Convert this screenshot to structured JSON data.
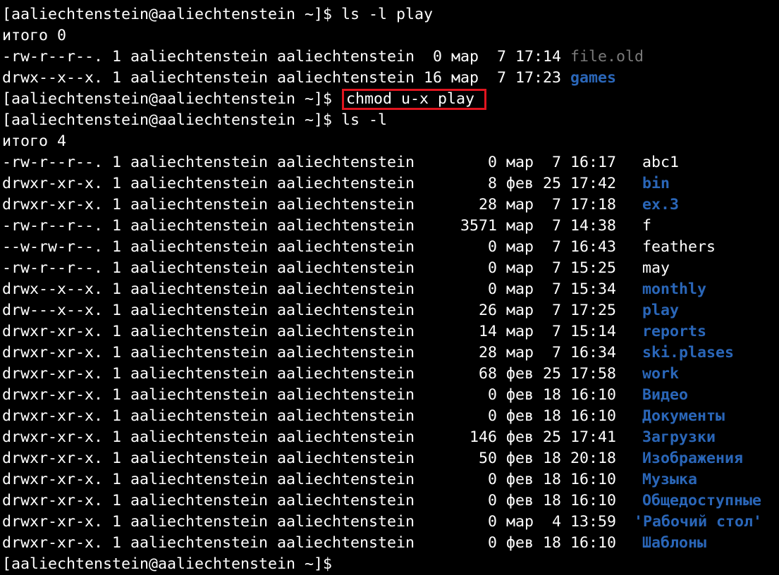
{
  "terminal": {
    "prompt": "[aaliechtenstein@aaliechtenstein ~]$ ",
    "commands": {
      "first": "ls -l play",
      "second": "chmod u-x play",
      "third": "ls -l"
    },
    "totals": {
      "first": "итого 0",
      "second": "итого 4"
    },
    "colors": {
      "background": "#000000",
      "text": "#ffffff",
      "directory": "#2a66b8",
      "dim_file": "#7a7a7a",
      "highlight_box": "#e0151f"
    },
    "play_listing": [
      {
        "cols": "-rw-r--r--. 1 aaliechtenstein aaliechtenstein  0 мар  7 17:14 ",
        "name": "file.old",
        "kind": "dim"
      },
      {
        "cols": "drwx--x--x. 1 aaliechtenstein aaliechtenstein 16 мар  7 17:23 ",
        "name": "games",
        "kind": "dir"
      }
    ],
    "home_listing": [
      {
        "cols": "-rw-r--r--. 1 aaliechtenstein aaliechtenstein",
        "time": "   0 мар  7 16:17",
        "name": "abc1",
        "kind": "file"
      },
      {
        "cols": "drwxr-xr-x. 1 aaliechtenstein aaliechtenstein",
        "time": "   8 фев 25 17:42",
        "name": "bin",
        "kind": "dir"
      },
      {
        "cols": "drwxr-xr-x. 1 aaliechtenstein aaliechtenstein",
        "time": "  28 мар  7 17:18",
        "name": "ex.3",
        "kind": "dir"
      },
      {
        "cols": "-rw-r--r--. 1 aaliechtenstein aaliechtenstein",
        "time": "3571 мар  7 14:38",
        "name": "f",
        "kind": "file"
      },
      {
        "cols": "--w-rw-r--. 1 aaliechtenstein aaliechtenstein",
        "time": "   0 мар  7 16:43",
        "name": "feathers",
        "kind": "file"
      },
      {
        "cols": "-rw-r--r--. 1 aaliechtenstein aaliechtenstein",
        "time": "   0 мар  7 15:25",
        "name": "may",
        "kind": "file"
      },
      {
        "cols": "drwx--x--x. 1 aaliechtenstein aaliechtenstein",
        "time": "   0 мар  7 15:34",
        "name": "monthly",
        "kind": "dir"
      },
      {
        "cols": "drw---x--x. 1 aaliechtenstein aaliechtenstein",
        "time": "  26 мар  7 17:25",
        "name": "play",
        "kind": "dir"
      },
      {
        "cols": "drwxr-xr-x. 1 aaliechtenstein aaliechtenstein",
        "time": "  14 мар  7 15:14",
        "name": "reports",
        "kind": "dir"
      },
      {
        "cols": "drwxr-xr-x. 1 aaliechtenstein aaliechtenstein",
        "time": "  28 мар  7 16:34",
        "name": "ski.plases",
        "kind": "dir"
      },
      {
        "cols": "drwxr-xr-x. 1 aaliechtenstein aaliechtenstein",
        "time": "  68 фев 25 17:58",
        "name": "work",
        "kind": "dir"
      },
      {
        "cols": "drwxr-xr-x. 1 aaliechtenstein aaliechtenstein",
        "time": "   0 фев 18 16:10",
        "name": "Видео",
        "kind": "dir"
      },
      {
        "cols": "drwxr-xr-x. 1 aaliechtenstein aaliechtenstein",
        "time": "   0 фев 18 16:10",
        "name": "Документы",
        "kind": "dir"
      },
      {
        "cols": "drwxr-xr-x. 1 aaliechtenstein aaliechtenstein",
        "time": " 146 фев 25 17:41",
        "name": "Загрузки",
        "kind": "dir"
      },
      {
        "cols": "drwxr-xr-x. 1 aaliechtenstein aaliechtenstein",
        "time": "  50 фев 18 20:18",
        "name": "Изображения",
        "kind": "dir"
      },
      {
        "cols": "drwxr-xr-x. 1 aaliechtenstein aaliechtenstein",
        "time": "   0 фев 18 16:10",
        "name": "Музыка",
        "kind": "dir"
      },
      {
        "cols": "drwxr-xr-x. 1 aaliechtenstein aaliechtenstein",
        "time": "   0 фев 18 16:10",
        "name": "Общедоступные",
        "kind": "dir"
      },
      {
        "cols": "drwxr-xr-x. 1 aaliechtenstein aaliechtenstein",
        "time": "   0 мар  4 13:59",
        "name": "'Рабочий стол'",
        "kind": "dir"
      },
      {
        "cols": "drwxr-xr-x. 1 aaliechtenstein aaliechtenstein",
        "time": "   0 фев 18 16:10",
        "name": "Шаблоны",
        "kind": "dir"
      }
    ]
  }
}
